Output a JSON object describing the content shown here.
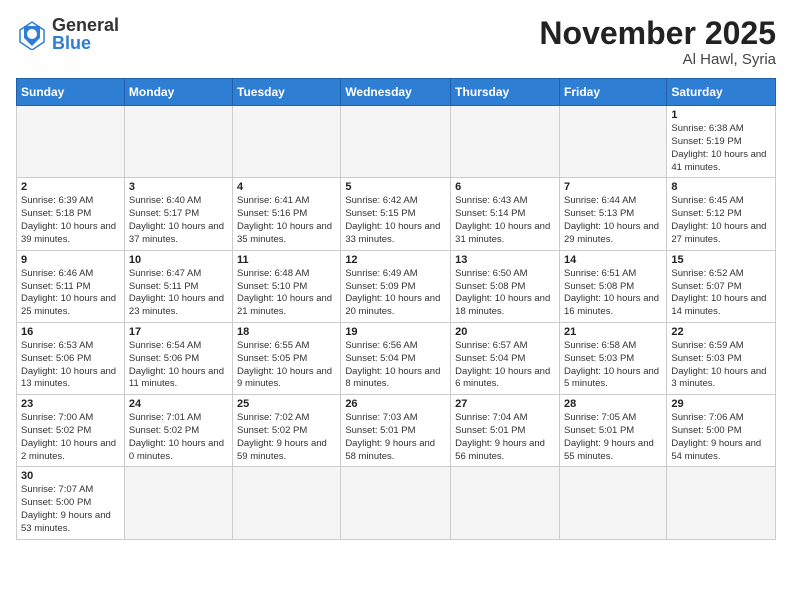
{
  "header": {
    "logo_general": "General",
    "logo_blue": "Blue",
    "month_title": "November 2025",
    "location": "Al Hawl, Syria"
  },
  "weekdays": [
    "Sunday",
    "Monday",
    "Tuesday",
    "Wednesday",
    "Thursday",
    "Friday",
    "Saturday"
  ],
  "weeks": [
    [
      {
        "day": "",
        "empty": true
      },
      {
        "day": "",
        "empty": true
      },
      {
        "day": "",
        "empty": true
      },
      {
        "day": "",
        "empty": true
      },
      {
        "day": "",
        "empty": true
      },
      {
        "day": "",
        "empty": true
      },
      {
        "day": "1",
        "sunrise": "6:38 AM",
        "sunset": "5:19 PM",
        "daylight": "10 hours and 41 minutes."
      }
    ],
    [
      {
        "day": "2",
        "sunrise": "6:39 AM",
        "sunset": "5:18 PM",
        "daylight": "10 hours and 39 minutes."
      },
      {
        "day": "3",
        "sunrise": "6:40 AM",
        "sunset": "5:17 PM",
        "daylight": "10 hours and 37 minutes."
      },
      {
        "day": "4",
        "sunrise": "6:41 AM",
        "sunset": "5:16 PM",
        "daylight": "10 hours and 35 minutes."
      },
      {
        "day": "5",
        "sunrise": "6:42 AM",
        "sunset": "5:15 PM",
        "daylight": "10 hours and 33 minutes."
      },
      {
        "day": "6",
        "sunrise": "6:43 AM",
        "sunset": "5:14 PM",
        "daylight": "10 hours and 31 minutes."
      },
      {
        "day": "7",
        "sunrise": "6:44 AM",
        "sunset": "5:13 PM",
        "daylight": "10 hours and 29 minutes."
      },
      {
        "day": "8",
        "sunrise": "6:45 AM",
        "sunset": "5:12 PM",
        "daylight": "10 hours and 27 minutes."
      }
    ],
    [
      {
        "day": "9",
        "sunrise": "6:46 AM",
        "sunset": "5:11 PM",
        "daylight": "10 hours and 25 minutes."
      },
      {
        "day": "10",
        "sunrise": "6:47 AM",
        "sunset": "5:11 PM",
        "daylight": "10 hours and 23 minutes."
      },
      {
        "day": "11",
        "sunrise": "6:48 AM",
        "sunset": "5:10 PM",
        "daylight": "10 hours and 21 minutes."
      },
      {
        "day": "12",
        "sunrise": "6:49 AM",
        "sunset": "5:09 PM",
        "daylight": "10 hours and 20 minutes."
      },
      {
        "day": "13",
        "sunrise": "6:50 AM",
        "sunset": "5:08 PM",
        "daylight": "10 hours and 18 minutes."
      },
      {
        "day": "14",
        "sunrise": "6:51 AM",
        "sunset": "5:08 PM",
        "daylight": "10 hours and 16 minutes."
      },
      {
        "day": "15",
        "sunrise": "6:52 AM",
        "sunset": "5:07 PM",
        "daylight": "10 hours and 14 minutes."
      }
    ],
    [
      {
        "day": "16",
        "sunrise": "6:53 AM",
        "sunset": "5:06 PM",
        "daylight": "10 hours and 13 minutes."
      },
      {
        "day": "17",
        "sunrise": "6:54 AM",
        "sunset": "5:06 PM",
        "daylight": "10 hours and 11 minutes."
      },
      {
        "day": "18",
        "sunrise": "6:55 AM",
        "sunset": "5:05 PM",
        "daylight": "10 hours and 9 minutes."
      },
      {
        "day": "19",
        "sunrise": "6:56 AM",
        "sunset": "5:04 PM",
        "daylight": "10 hours and 8 minutes."
      },
      {
        "day": "20",
        "sunrise": "6:57 AM",
        "sunset": "5:04 PM",
        "daylight": "10 hours and 6 minutes."
      },
      {
        "day": "21",
        "sunrise": "6:58 AM",
        "sunset": "5:03 PM",
        "daylight": "10 hours and 5 minutes."
      },
      {
        "day": "22",
        "sunrise": "6:59 AM",
        "sunset": "5:03 PM",
        "daylight": "10 hours and 3 minutes."
      }
    ],
    [
      {
        "day": "23",
        "sunrise": "7:00 AM",
        "sunset": "5:02 PM",
        "daylight": "10 hours and 2 minutes."
      },
      {
        "day": "24",
        "sunrise": "7:01 AM",
        "sunset": "5:02 PM",
        "daylight": "10 hours and 0 minutes."
      },
      {
        "day": "25",
        "sunrise": "7:02 AM",
        "sunset": "5:02 PM",
        "daylight": "9 hours and 59 minutes."
      },
      {
        "day": "26",
        "sunrise": "7:03 AM",
        "sunset": "5:01 PM",
        "daylight": "9 hours and 58 minutes."
      },
      {
        "day": "27",
        "sunrise": "7:04 AM",
        "sunset": "5:01 PM",
        "daylight": "9 hours and 56 minutes."
      },
      {
        "day": "28",
        "sunrise": "7:05 AM",
        "sunset": "5:01 PM",
        "daylight": "9 hours and 55 minutes."
      },
      {
        "day": "29",
        "sunrise": "7:06 AM",
        "sunset": "5:00 PM",
        "daylight": "9 hours and 54 minutes."
      }
    ],
    [
      {
        "day": "30",
        "sunrise": "7:07 AM",
        "sunset": "5:00 PM",
        "daylight": "9 hours and 53 minutes."
      },
      {
        "day": "",
        "empty": true
      },
      {
        "day": "",
        "empty": true
      },
      {
        "day": "",
        "empty": true
      },
      {
        "day": "",
        "empty": true
      },
      {
        "day": "",
        "empty": true
      },
      {
        "day": "",
        "empty": true
      }
    ]
  ],
  "labels": {
    "sunrise": "Sunrise:",
    "sunset": "Sunset:",
    "daylight": "Daylight:"
  }
}
